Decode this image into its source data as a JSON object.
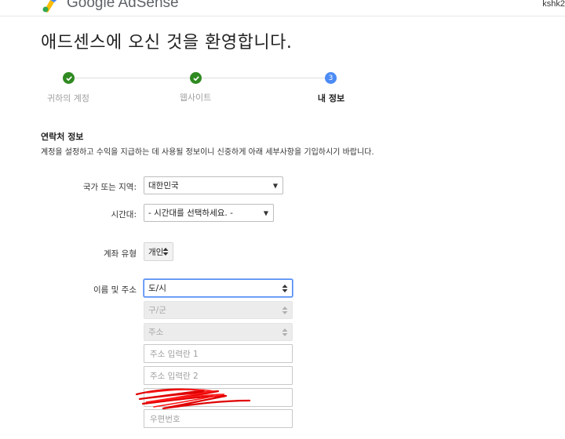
{
  "header": {
    "brand": "Google AdSense",
    "user": "kshk2"
  },
  "page": {
    "welcome": "애드센스에 오신 것을 환영합니다."
  },
  "stepper": {
    "steps": [
      {
        "label": "귀하의 계정",
        "state": "done"
      },
      {
        "label": "웹사이트",
        "state": "done"
      },
      {
        "label": "내 정보",
        "state": "current",
        "number": "3"
      }
    ]
  },
  "contact": {
    "title": "연락처 정보",
    "description": "계정을 설정하고 수익을 지급하는 데 사용될 정보이니 신중하게 아래 세부사항을 기입하시기 바랍니다."
  },
  "form": {
    "country_label": "국가 또는 지역:",
    "country_value": "대한민국",
    "timezone_label": "시간대:",
    "timezone_value": "- 시간대를 선택하세요. -",
    "account_type_label": "계좌 유형",
    "account_type_value": "개인",
    "name_address_label": "이름 및 주소",
    "city_value": "도/시",
    "district_placeholder": "구/군",
    "street_placeholder": "주소",
    "address1_placeholder": "주소 입력란 1",
    "address2_placeholder": "주소 입력란 2",
    "postal_placeholder": "우편번호"
  },
  "colors": {
    "done": "#2f8a21",
    "current": "#4c8bf5",
    "redaction": "#e00000"
  }
}
